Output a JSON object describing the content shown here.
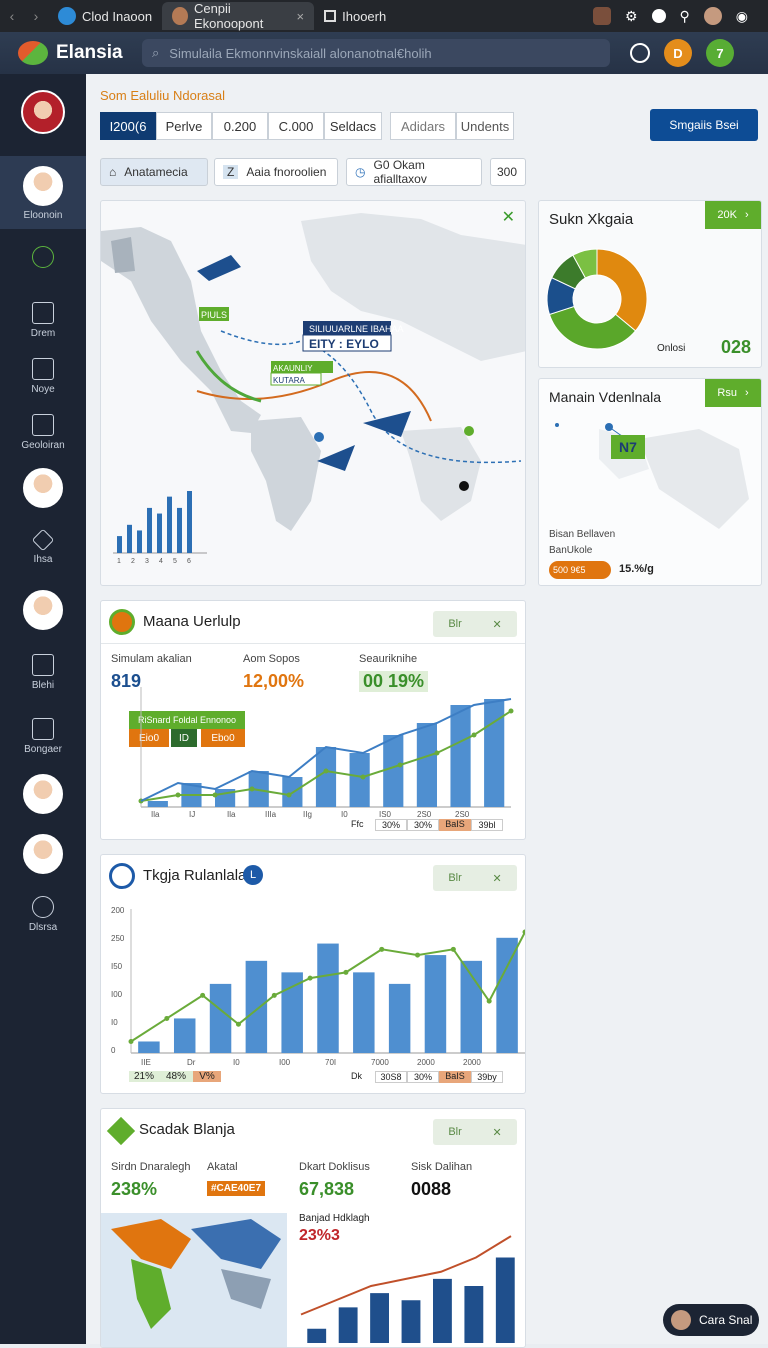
{
  "browser": {
    "tab1": "Clod Inaoon",
    "tab2": "Cenpii Ekonoopont",
    "tab2_close": "×",
    "tab3": "Ihooerh"
  },
  "app": {
    "title": "Elansia",
    "search_placeholder": "Simulaila Ekmonnvinskaiall alonanotnal€holih"
  },
  "sidebar": {
    "items": [
      {
        "label": ""
      },
      {
        "label": "Eloonoin"
      },
      {
        "label": ""
      },
      {
        "label": "Drem"
      },
      {
        "label": "Noye"
      },
      {
        "label": "Geoloiran"
      },
      {
        "label": ""
      },
      {
        "label": "Ihsa"
      },
      {
        "label": ""
      },
      {
        "label": "Blehi"
      },
      {
        "label": "Bongaer"
      },
      {
        "label": ""
      },
      {
        "label": ""
      },
      {
        "label": "Dlsrsa"
      }
    ]
  },
  "header": {
    "subtitle": "Som Ealuliu Ndorasal",
    "segments": [
      "I200(6",
      "Perlve",
      "0.200",
      "C.000",
      "Seldacs",
      "Adidars",
      "Undents"
    ],
    "primary_button": "Smgaiis Bsei"
  },
  "filters": [
    {
      "label": "Anatamecia"
    },
    {
      "label": "Aaia fnoroolien"
    },
    {
      "label": "G0 Okam afialltaxov"
    },
    {
      "label": "300"
    }
  ],
  "map_card": {
    "banner": "SILIUUARLNE IBAHAA",
    "banner2": "EITY : EYLO",
    "label1": "PIULS",
    "label2": "AKAUNLIY",
    "label3": "KUTARA",
    "bar_ticks": [
      "1",
      "2",
      "3",
      "4",
      "5",
      "6"
    ],
    "bars": [
      3,
      5,
      4,
      8,
      7,
      10,
      8,
      11
    ]
  },
  "pie_card": {
    "title": "Sukn Xkgaia",
    "tag": "20K",
    "legend": "Onlosi",
    "value": "028",
    "slices": [
      {
        "value": 36,
        "color": "#e0890f"
      },
      {
        "value": 34,
        "color": "#5aa72a"
      },
      {
        "value": 12,
        "color": "#1b4f8c"
      },
      {
        "value": 10,
        "color": "#3c7b2b"
      },
      {
        "value": 8,
        "color": "#7bc043"
      }
    ]
  },
  "map2_card": {
    "title": "Manain Vdenlnala",
    "tag": "Rsu",
    "badge": "N7",
    "caption1": "Bisan Bellaven",
    "caption2": "BanUkole",
    "pill": "500 9€5",
    "pill_value": "15.%/g"
  },
  "chart1": {
    "title": "Maana Uerlulp",
    "tools": [
      "Blr",
      "✕"
    ],
    "stats": [
      {
        "label": "Simulam akalian",
        "value": "819",
        "color": "#1c4f8f"
      },
      {
        "label": "Aom Sopos",
        "value": "12,00%",
        "color": "#e0750f"
      },
      {
        "label": "Seauriknihe",
        "value": "00 19%",
        "color": "#3a8f2a"
      }
    ],
    "legend_box": "RiSnard Foldal Ennonoo",
    "legend_pills": [
      "Eio0",
      "ID",
      "Ebo0"
    ],
    "x_ticks": [
      "Ila",
      "IJ",
      "Ila",
      "IIIa",
      "IIg",
      "I0",
      "IS0",
      "2S0",
      "2S0"
    ],
    "footer": [
      "Ffc",
      "30%",
      "30%",
      "BaIS",
      "39bl"
    ],
    "chart_data": {
      "type": "bar",
      "categories": [
        "Ila",
        "IJ",
        "Ila",
        "IIIa",
        "IIg",
        "I0",
        "IS0",
        "2S0",
        "2S0",
        "2S0"
      ],
      "series": [
        {
          "values": [
            1,
            2,
            2,
            3,
            2,
            6,
            5,
            7,
            9,
            12,
            16
          ]
        },
        {
          "values": [
            1,
            4,
            3,
            6,
            5,
            10,
            9,
            12,
            14,
            17,
            18
          ]
        }
      ],
      "ylim": [
        0,
        20
      ]
    }
  },
  "chart2": {
    "title": "Tkgja Rulanlala",
    "tools": [
      "Blr",
      "✕"
    ],
    "y_ticks": [
      "200",
      "250",
      "I50",
      "I00",
      "I0",
      "0"
    ],
    "x_ticks": [
      "IIE",
      "Dr",
      "I0",
      "I00",
      "70I",
      "7000",
      "2000",
      "2000"
    ],
    "footer_left": [
      "21%",
      "48%",
      "V%"
    ],
    "footer_right": [
      "Dk",
      "30S8",
      "30%",
      "BaIS",
      "39by"
    ],
    "chart_data": {
      "type": "bar",
      "categories": [
        "IIE",
        "Dr",
        "I0",
        "I00",
        "70I",
        "7000",
        "2000",
        "2000"
      ],
      "series": [
        {
          "values": [
            20,
            60,
            100,
            50,
            100,
            130,
            140,
            180,
            170,
            180,
            90,
            210
          ]
        },
        {
          "values": [
            20,
            60,
            120,
            160,
            140,
            190,
            140,
            120,
            170,
            160,
            200
          ]
        }
      ],
      "ylim": [
        0,
        250
      ]
    }
  },
  "chart3": {
    "title": "Scadak Blanja",
    "tools": [
      "Blr",
      "✕"
    ],
    "stats": [
      {
        "label": "Sirdn Dnaralegh",
        "value": "238%",
        "color": "#3a8f2a"
      },
      {
        "label": "Akatal",
        "value": "#CAE40E7",
        "color": "#e0750f"
      },
      {
        "label": "Dkart Doklisus",
        "value": "67,838",
        "color": "#3a8f2a"
      },
      {
        "label": "Sisk Dalihan",
        "value": "0088",
        "color": "#111"
      }
    ],
    "inset_label": "Banjad Hdklagh",
    "inset_value": "23%3",
    "chart_data": {
      "type": "bar",
      "categories": [
        "1",
        "2",
        "3",
        "4",
        "5",
        "6",
        "7"
      ],
      "values": [
        2,
        5,
        7,
        6,
        9,
        8,
        12
      ],
      "line": [
        4,
        6,
        8,
        9,
        10,
        12,
        15
      ],
      "ylim": [
        0,
        16
      ]
    }
  },
  "chat": {
    "label": "Cara Snal"
  }
}
